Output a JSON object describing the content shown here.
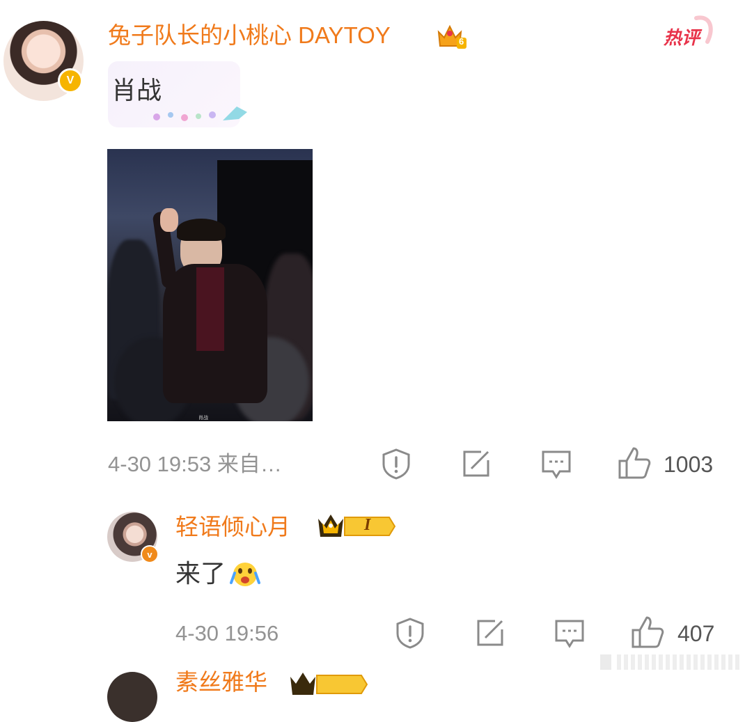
{
  "colors": {
    "username": "#f07a1b",
    "hot_badge": "#e8334a",
    "meta": "#939393",
    "vip_gold": "#f6b400"
  },
  "comment": {
    "username": "兔子队长的小桃心 DAYTOY",
    "level_badge_icon": "crown-level-icon",
    "level_number": "6",
    "verified_mark": "V",
    "hot_badge": "热评",
    "text": "肖战",
    "photo_caption": "肖战",
    "timestamp": "4-30 19:53 来自…",
    "likes": "1003"
  },
  "reply": {
    "username": "轻语倾心月",
    "vip_level": "I",
    "verified_mark": "v",
    "text": "来了",
    "emoji_icon": "crying-face-icon",
    "timestamp": "4-30 19:56",
    "likes": "407"
  },
  "next_comment": {
    "username_partial": "素丝雅华"
  },
  "actions": [
    "report-icon",
    "share-icon",
    "comment-icon",
    "like-icon"
  ]
}
